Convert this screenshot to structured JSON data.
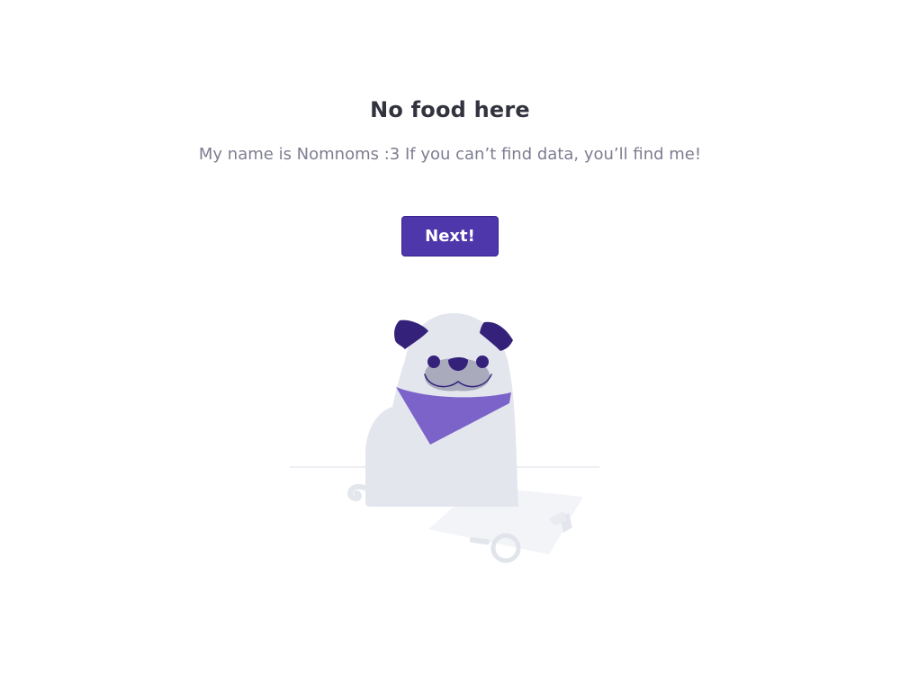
{
  "empty_state": {
    "title": "No food here",
    "message": "My name is Nomnoms :3 If you can’t find data, you’ll find me!",
    "button_label": "Next!",
    "illustration": "pug-mascot-illustration"
  },
  "colors": {
    "accent": "#4e36ab",
    "title": "#33333f",
    "message": "#7d7d91",
    "bandana": "#7b63c9",
    "pug_body": "#e4e6ee",
    "pug_ears": "#34217a"
  }
}
